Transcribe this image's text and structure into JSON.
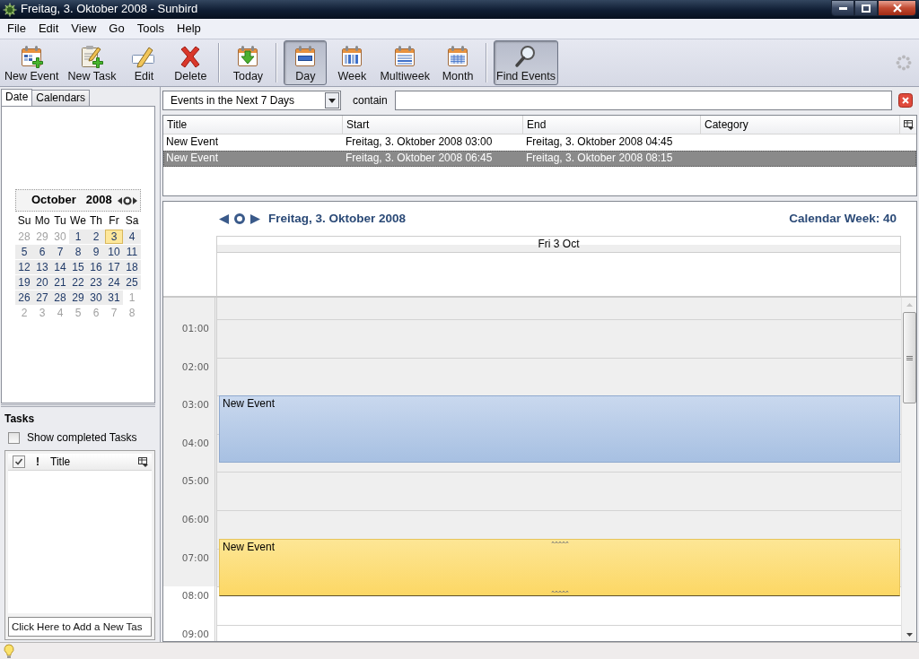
{
  "window": {
    "title": "Freitag, 3. Oktober 2008 - Sunbird"
  },
  "menu": [
    "File",
    "Edit",
    "View",
    "Go",
    "Tools",
    "Help"
  ],
  "toolbar": {
    "groups": [
      [
        {
          "label": "New Event",
          "kind": "newevent",
          "selected": false
        },
        {
          "label": "New Task",
          "kind": "newtask",
          "selected": false
        },
        {
          "label": "Edit",
          "kind": "edit",
          "selected": false
        },
        {
          "label": "Delete",
          "kind": "delete",
          "selected": false
        }
      ],
      [
        {
          "label": "Today",
          "kind": "today",
          "selected": false
        }
      ],
      [
        {
          "label": "Day",
          "kind": "day",
          "selected": true
        },
        {
          "label": "Week",
          "kind": "week",
          "selected": false
        },
        {
          "label": "Multiweek",
          "kind": "multiweek",
          "selected": false
        },
        {
          "label": "Month",
          "kind": "month",
          "selected": false
        }
      ],
      [
        {
          "label": "Find Events",
          "kind": "find",
          "selected": true
        }
      ]
    ]
  },
  "sidebar": {
    "tabs": [
      {
        "label": "Date",
        "selected": true
      },
      {
        "label": "Calendars",
        "selected": false
      }
    ],
    "minimonth": {
      "month": "October",
      "year": "2008",
      "weekdays": [
        "Su",
        "Mo",
        "Tu",
        "We",
        "Th",
        "Fr",
        "Sa"
      ],
      "weeks": [
        [
          {
            "day": "28",
            "outside": true,
            "selected": false
          },
          {
            "day": "29",
            "outside": true,
            "selected": false
          },
          {
            "day": "30",
            "outside": true,
            "selected": false
          },
          {
            "day": "1",
            "outside": false,
            "selected": false
          },
          {
            "day": "2",
            "outside": false,
            "selected": false
          },
          {
            "day": "3",
            "outside": false,
            "selected": true
          },
          {
            "day": "4",
            "outside": false,
            "selected": false
          }
        ],
        [
          {
            "day": "5",
            "outside": false,
            "selected": false
          },
          {
            "day": "6",
            "outside": false,
            "selected": false
          },
          {
            "day": "7",
            "outside": false,
            "selected": false
          },
          {
            "day": "8",
            "outside": false,
            "selected": false
          },
          {
            "day": "9",
            "outside": false,
            "selected": false
          },
          {
            "day": "10",
            "outside": false,
            "selected": false
          },
          {
            "day": "11",
            "outside": false,
            "selected": false
          }
        ],
        [
          {
            "day": "12",
            "outside": false,
            "selected": false
          },
          {
            "day": "13",
            "outside": false,
            "selected": false
          },
          {
            "day": "14",
            "outside": false,
            "selected": false
          },
          {
            "day": "15",
            "outside": false,
            "selected": false
          },
          {
            "day": "16",
            "outside": false,
            "selected": false
          },
          {
            "day": "17",
            "outside": false,
            "selected": false
          },
          {
            "day": "18",
            "outside": false,
            "selected": false
          }
        ],
        [
          {
            "day": "19",
            "outside": false,
            "selected": false
          },
          {
            "day": "20",
            "outside": false,
            "selected": false
          },
          {
            "day": "21",
            "outside": false,
            "selected": false
          },
          {
            "day": "22",
            "outside": false,
            "selected": false
          },
          {
            "day": "23",
            "outside": false,
            "selected": false
          },
          {
            "day": "24",
            "outside": false,
            "selected": false
          },
          {
            "day": "25",
            "outside": false,
            "selected": false
          }
        ],
        [
          {
            "day": "26",
            "outside": false,
            "selected": false
          },
          {
            "day": "27",
            "outside": false,
            "selected": false
          },
          {
            "day": "28",
            "outside": false,
            "selected": false
          },
          {
            "day": "29",
            "outside": false,
            "selected": false
          },
          {
            "day": "30",
            "outside": false,
            "selected": false
          },
          {
            "day": "31",
            "outside": false,
            "selected": false
          },
          {
            "day": "1",
            "outside": true,
            "selected": false
          }
        ],
        [
          {
            "day": "2",
            "outside": true,
            "selected": false
          },
          {
            "day": "3",
            "outside": true,
            "selected": false
          },
          {
            "day": "4",
            "outside": true,
            "selected": false
          },
          {
            "day": "5",
            "outside": true,
            "selected": false
          },
          {
            "day": "6",
            "outside": true,
            "selected": false
          },
          {
            "day": "7",
            "outside": true,
            "selected": false
          },
          {
            "day": "8",
            "outside": true,
            "selected": false
          }
        ]
      ]
    }
  },
  "tasks": {
    "title": "Tasks",
    "show_completed": {
      "label": "Show completed Tasks",
      "checked": false
    },
    "columns": [
      {
        "kind": "done"
      },
      {
        "kind": "priority",
        "label": "!"
      },
      {
        "kind": "title",
        "label": "Title"
      }
    ],
    "new_task": {
      "placeholder": "Click Here to Add a New Tas"
    }
  },
  "search": {
    "filter": "Events in the Next 7 Days",
    "contain_label": "contain"
  },
  "event_list": {
    "columns": [
      "Title",
      "Start",
      "End",
      "Category"
    ],
    "rows": [
      {
        "cells": [
          "New Event",
          "Freitag, 3. Oktober 2008 03:00",
          "Freitag, 3. Oktober 2008 04:45"
        ],
        "selected": false
      },
      {
        "cells": [
          "New Event",
          "Freitag, 3. Oktober 2008 06:45",
          "Freitag, 3. Oktober 2008 08:15"
        ],
        "selected": true
      }
    ]
  },
  "day_view": {
    "title": "Freitag, 3. Oktober 2008",
    "week": "Calendar Week: 40",
    "column": "Fri 3 Oct",
    "hours": [
      {
        "label": "01:00",
        "off_hours": true
      },
      {
        "label": "02:00",
        "off_hours": true
      },
      {
        "label": "03:00",
        "off_hours": true
      },
      {
        "label": "04:00",
        "off_hours": true
      },
      {
        "label": "05:00",
        "off_hours": true
      },
      {
        "label": "06:00",
        "off_hours": true
      },
      {
        "label": "07:00",
        "off_hours": true
      },
      {
        "label": "08:00",
        "off_hours": false
      },
      {
        "label": "09:00",
        "off_hours": false
      }
    ],
    "events": [
      {
        "title": "New Event",
        "selected": false
      },
      {
        "title": "New Event",
        "selected": true
      }
    ]
  }
}
